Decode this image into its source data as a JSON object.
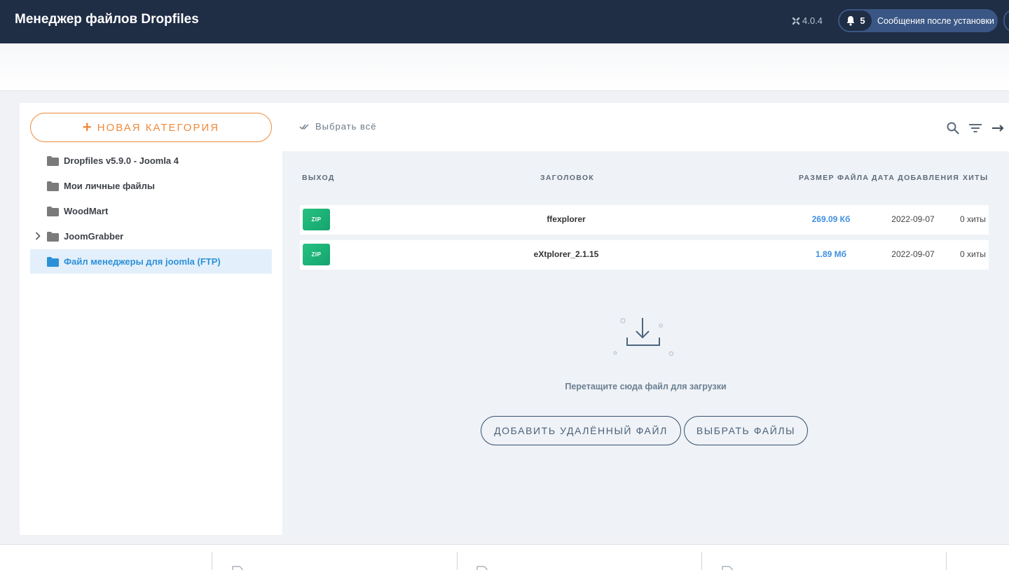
{
  "header": {
    "title": "Менеджер файлов Dropfiles",
    "version": "4.0.4",
    "notifications_count": "5",
    "notifications_label": "Сообщения после установки"
  },
  "sidebar": {
    "new_category_label": "НОВАЯ КАТЕГОРИЯ",
    "categories": [
      {
        "label": "Dropfiles v5.9.0 - Joomla 4",
        "active": false,
        "expandable": false
      },
      {
        "label": "Мои личные файлы",
        "active": false,
        "expandable": false
      },
      {
        "label": "WoodMart",
        "active": false,
        "expandable": false
      },
      {
        "label": "JoomGrabber",
        "active": false,
        "expandable": true
      },
      {
        "label": "Файл менеджеры для joomla (FTP)",
        "active": true,
        "expandable": false
      }
    ]
  },
  "toolbar": {
    "select_all_label": "Выбрать всё",
    "icons": [
      "search-icon",
      "filter-icon",
      "arrow-right-icon"
    ]
  },
  "table": {
    "columns": {
      "output": "ВЫХОД",
      "title": "ЗАГОЛОВОК",
      "size": "РАЗМЕР ФАЙЛА",
      "date": "ДАТА ДОБАВЛЕНИЯ",
      "hits": "ХИТЫ"
    },
    "rows": [
      {
        "type": "ZIP",
        "title": "ffexplorer",
        "size": "269.09 Кб",
        "date": "2022-09-07",
        "hits": "0 хиты"
      },
      {
        "type": "ZIP",
        "title": "eXtplorer_2.1.15",
        "size": "1.89 Мб",
        "date": "2022-09-07",
        "hits": "0 хиты"
      }
    ]
  },
  "dropzone": {
    "text": "Перетащите сюда файл для загрузки",
    "add_remote_label": "ДОБАВИТЬ УДАЛЁННЫЙ ФАЙЛ",
    "select_files_label": "ВЫБРАТЬ ФАЙЛЫ"
  },
  "colors": {
    "header_bg": "#1f2d45",
    "accent_orange": "#f08a3b",
    "active_blue": "#2c90d8",
    "zip_green": "#1cb379"
  }
}
